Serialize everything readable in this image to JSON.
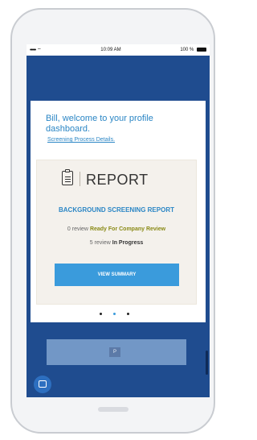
{
  "status_bar": {
    "signal": "•••••",
    "wifi": "⌔",
    "time": "10:09 AM",
    "battery": "100 %"
  },
  "welcome": "Bill, welcome to your profile dashboard.",
  "link": "Screening Process Details.",
  "report": {
    "heading": "REPORT",
    "title": "BACKGROUND SCREENING REPORT",
    "reviews": [
      {
        "prefix": "0 review",
        "status": "Ready For Company Review"
      },
      {
        "prefix": "5 review",
        "status": "In Progress"
      }
    ],
    "button_label": "VIEW SUMMARY"
  },
  "pager": {
    "count": 3,
    "active": 1
  },
  "second_card": {
    "button_label": "P"
  }
}
